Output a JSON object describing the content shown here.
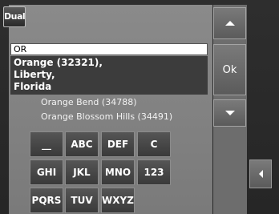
{
  "brand": {
    "logo_text": "Dual"
  },
  "search": {
    "value": "OR"
  },
  "results": {
    "selected": {
      "lines": [
        "Orange (32321),",
        "Liberty,",
        "Florida"
      ]
    },
    "items": [
      "Orange Bend (34788)",
      "Orange Blossom Hills (34491)"
    ]
  },
  "controls": {
    "ok_label": "Ok",
    "scroll_up_icon": "triangle-up-icon",
    "scroll_down_icon": "triangle-down-icon",
    "back_icon": "triangle-left-icon"
  },
  "keypad": {
    "rows": [
      [
        "__",
        "ABC",
        "DEF",
        "C"
      ],
      [
        "GHI",
        "JKL",
        "MNO",
        "123"
      ],
      [
        "PQRS",
        "TUV",
        "WXYZ"
      ]
    ]
  }
}
